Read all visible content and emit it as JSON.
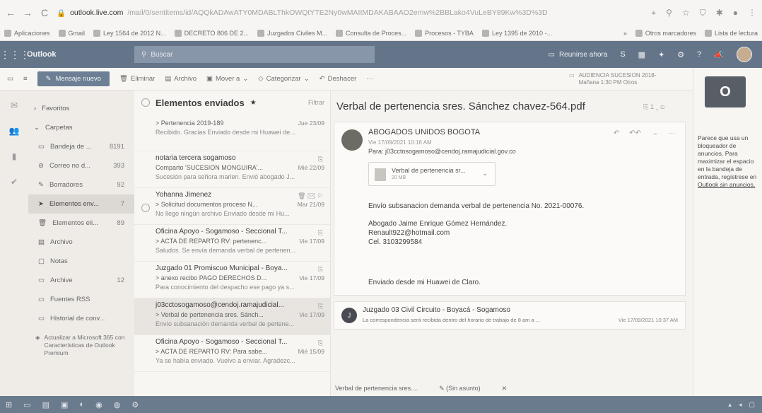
{
  "browser": {
    "domain": "outlook.live.com",
    "path": "/mail/0/sentitems/id/AQQkADAwATY0MDABLThkOWQtYTE2Ny0wMAItMDAKABAAO2emw%2BBLako4VuLeBY89Kw%3D%3D",
    "bookmarks": [
      "Aplicaciones",
      "Gmail",
      "Ley 1564 de 2012 N...",
      "DECRETO 806 DE 2...",
      "Juzgados Civiles M...",
      "Consulta de Proces...",
      "Procesos - TYBA",
      "Ley 1395 de 2010 -..."
    ],
    "bookmarks_more": "»",
    "other_bookmarks": "Otros marcadores",
    "reading_list": "Lista de lectura"
  },
  "suite": {
    "brand": "Outlook",
    "search_placeholder": "Buscar",
    "meet_now": "Reunirse ahora"
  },
  "commands": {
    "new_message": "Mensaje nuevo",
    "delete": "Eliminar",
    "archive": "Archivo",
    "move_to": "Mover a",
    "categorize": "Categorizar",
    "undo": "Deshacer",
    "more": "···",
    "reminder_title": "AUDIENCIA SUCESION 2018-",
    "reminder_time": "Mañana 1:30 PM Otros"
  },
  "folders": {
    "favorites": "Favoritos",
    "folders": "Carpetas",
    "items": [
      {
        "label": "Bandeja de ...",
        "count": "8191"
      },
      {
        "label": "Correo no d...",
        "count": "393"
      },
      {
        "label": "Borradores",
        "count": "92"
      },
      {
        "label": "Elementos env...",
        "count": "7"
      },
      {
        "label": "Elementos eli...",
        "count": "89"
      },
      {
        "label": "Archivo",
        "count": ""
      },
      {
        "label": "Notas",
        "count": ""
      },
      {
        "label": "Archive",
        "count": "12"
      },
      {
        "label": "Fuentes RSS",
        "count": ""
      },
      {
        "label": "Historial de conv...",
        "count": ""
      }
    ],
    "upgrade": "Actualizar a Microsoft 365 con Características de Outlook Premium"
  },
  "list": {
    "title": "Elementos enviados",
    "filter": "Filtrar",
    "messages": [
      {
        "sender": "",
        "subject": "> Pertenencia 2019-189",
        "date": "Jue 23/09",
        "preview": "Recibido. Gracias Enviado desde mi Huawei de..."
      },
      {
        "sender": "notaria tercera sogamoso",
        "subject": "Comparto 'SUCESION MONGUIRA'...",
        "date": "Mié 22/09",
        "preview": "Sucesión para señora marien. Envió abogado J..."
      },
      {
        "sender": "Yohanna Jimenez",
        "subject": "> Solicitud documentos proceso N...",
        "date": "Mar 21/09",
        "preview": "No llego ningún archivo Enviado desde mi Hu..."
      },
      {
        "sender": "Oficina Apoyo - Sogamoso - Seccional T...",
        "subject": "> ACTA DE REPARTO RV: pertenenc...",
        "date": "Vie 17/09",
        "preview": "Saludos. Se envía demanda verbal de pertenen..."
      },
      {
        "sender": "Juzgado 01 Promiscuo Municipal - Boya...",
        "subject": "> anexo recibo PAGO DERECHOS D...",
        "date": "Vie 17/09",
        "preview": "Para conocimiento del despacho ese pago ya s..."
      },
      {
        "sender": "j03cctosogamoso@cendoj.ramajudicial...",
        "subject": "> Verbal de pertenencia sres. Sánch...",
        "date": "Vie 17/09",
        "preview": "Envío subsanación demanda verbal de pertene..."
      },
      {
        "sender": "Oficina Apoyo - Sogamoso - Seccional T...",
        "subject": "> ACTA DE REPARTO RV: Para sabe...",
        "date": "Mié 15/09",
        "preview": "Ya se había enviado. Vuelvo a enviar. Agradezc..."
      }
    ]
  },
  "reading": {
    "title": "Verbal de pertenencia sres. Sánchez chavez-564.pdf",
    "count": "1",
    "from": "ABOGADOS UNIDOS BOGOTA",
    "when": "Vie 17/09/2021 10:16 AM",
    "to": "Para: j03cctosogamoso@cendoj.ramajudicial.gov.co",
    "attachment_name": "Verbal de pertenencia sr...",
    "attachment_size": "20 MB",
    "body1": "Envío subsanacion demanda verbal de pertenencia No. 2021-00076.",
    "body2a": "Abogado Jaime Enrique Gómez Hernández.",
    "body2b": "Renault922@hotmail.com",
    "body2c": "Cel. 3103299584",
    "body3": "Enviado desde mi Huawei de Claro.",
    "reply_from": "Juzgado 03 Civil Circuito - Boyacá - Sogamoso",
    "reply_preview": "La correspondencia será recibida dentro del horario de trabajo de 8 am a ...",
    "reply_date": "Vie 17/09/2021 10:37 AM",
    "reply_initial": "J",
    "tab1": "Verbal de pertenencia sres....",
    "tab2": "(Sin asunto)"
  },
  "ad": {
    "text": "Parece que usa un bloqueador de anuncios. Para maximizar el espacio en la bandeja de entrada, regístrese en",
    "link": "Outlook sin anuncios."
  }
}
